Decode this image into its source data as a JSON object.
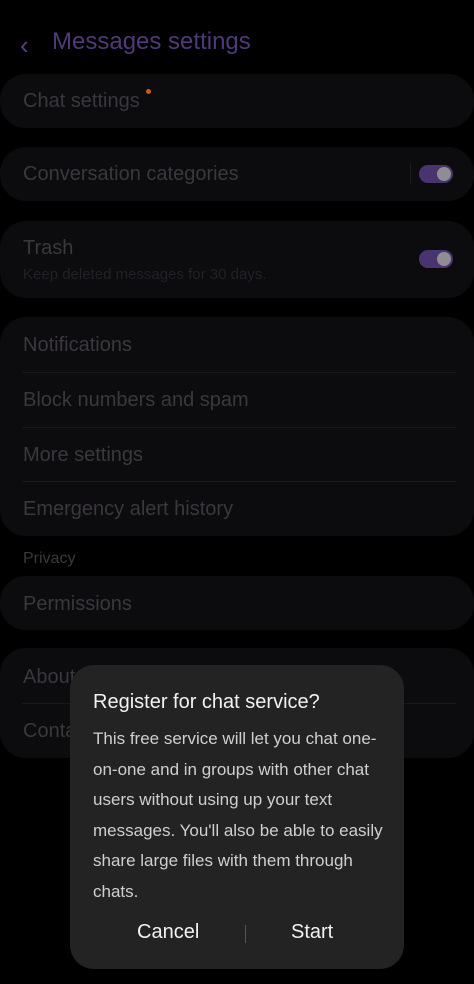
{
  "header": {
    "title": "Messages settings",
    "back_icon": "chevron-left-icon"
  },
  "settings": {
    "chat_settings": "Chat settings",
    "conversation_categories": "Conversation categories",
    "trash": "Trash",
    "trash_sub": "Keep deleted messages for 30 days.",
    "notifications": "Notifications",
    "block_numbers": "Block numbers and spam",
    "more_settings": "More settings",
    "emergency_alert": "Emergency alert history",
    "privacy_label": "Privacy",
    "permissions": "Permissions",
    "about": "About",
    "contact": "Conta"
  },
  "dialog": {
    "title": "Register for chat service?",
    "body": "This free service will let you chat one-on-one and in groups with other chat users without using up your text messages. You'll also be able to easily share large files with them through chats.",
    "cancel": "Cancel",
    "start": "Start"
  },
  "colors": {
    "accent": "#4a3470",
    "badge": "#c85a1c",
    "dialog_bg": "#232323"
  }
}
